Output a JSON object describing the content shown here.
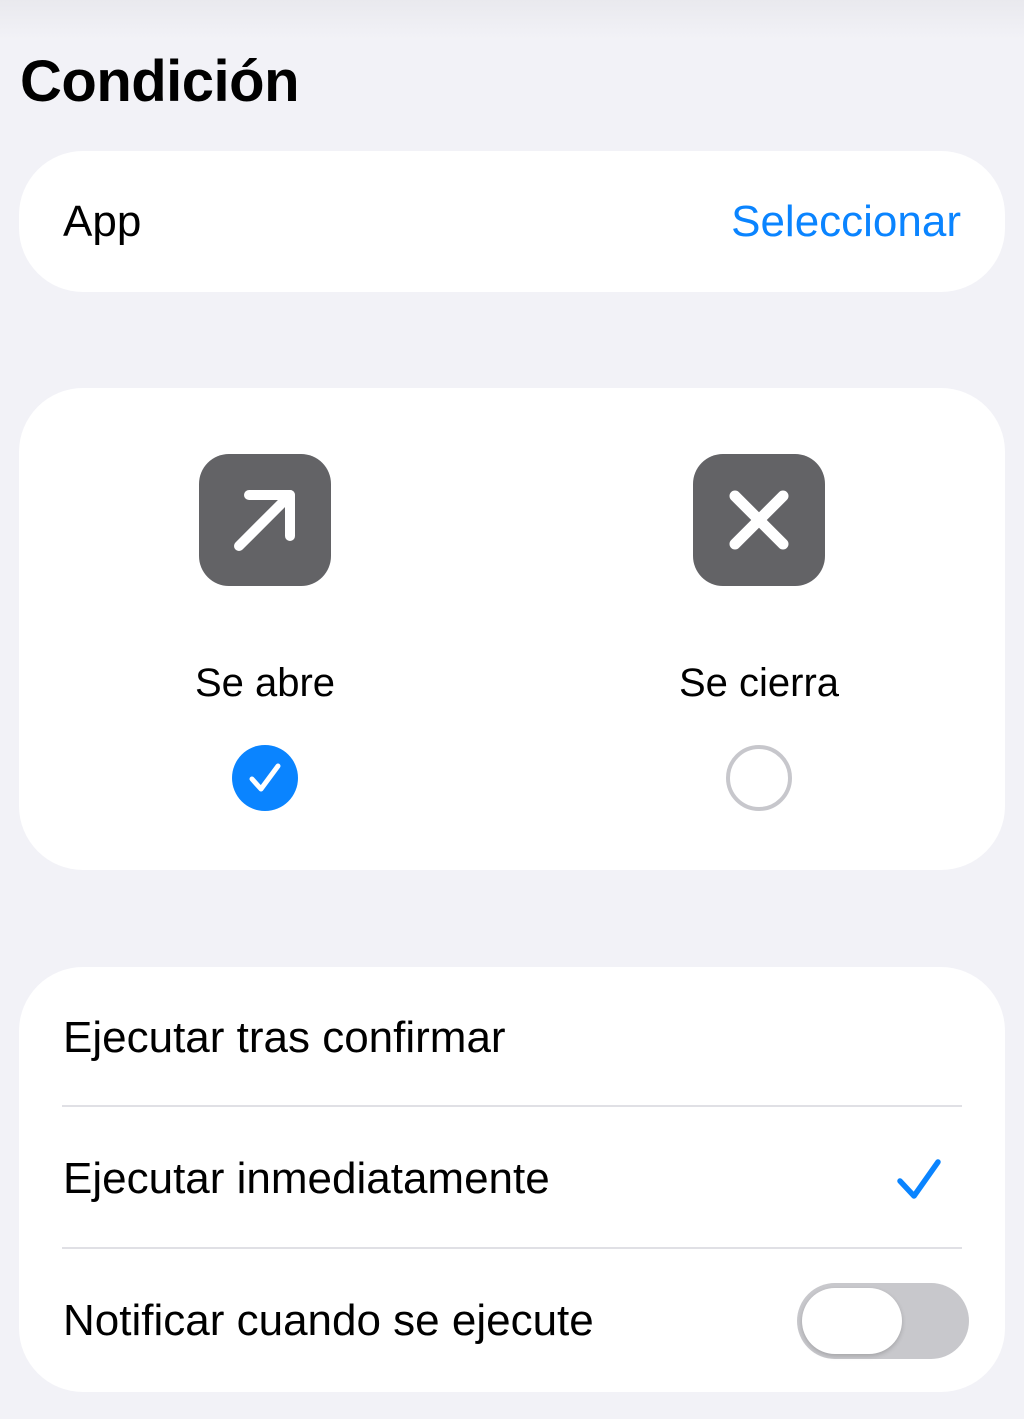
{
  "header": {
    "title": "Condición"
  },
  "app_row": {
    "label": "App",
    "action_label": "Seleccionar"
  },
  "condition": {
    "options": [
      {
        "label": "Se abre",
        "icon": "arrow-up-right-icon",
        "selected": true
      },
      {
        "label": "Se cierra",
        "icon": "xmark-icon",
        "selected": false
      }
    ]
  },
  "execution": {
    "options": [
      {
        "label": "Ejecutar tras confirmar",
        "selected": false
      },
      {
        "label": "Ejecutar inmediatamente",
        "selected": true
      }
    ],
    "notify": {
      "label": "Notificar cuando se ejecute",
      "enabled": false
    }
  },
  "colors": {
    "accent": "#0a84ff",
    "background": "#f2f2f7",
    "card": "#ffffff",
    "icon_tile": "#636366",
    "toggle_off": "#c8c8cc"
  }
}
